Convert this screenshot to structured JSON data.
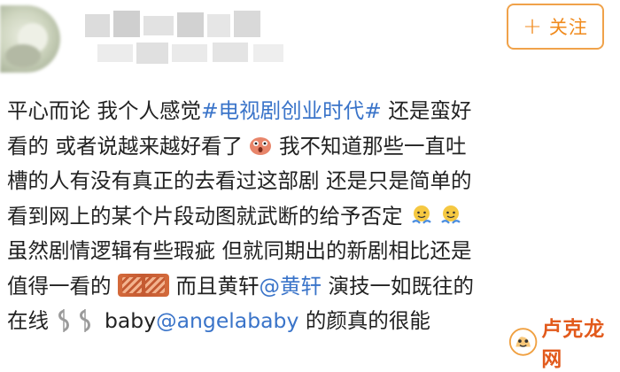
{
  "header": {
    "follow_button": {
      "plus_icon": "+",
      "label": "关注"
    }
  },
  "post": {
    "lines": [
      {
        "parts": [
          "平心而论  我个人感觉",
          "#电视剧创业时代#",
          " 还是蛮好"
        ]
      },
      {
        "parts": [
          "看的 或者说越来越好看了",
          "我不知道那些一直吐"
        ]
      },
      {
        "parts": [
          "槽的人有没有真正的去看过这部剧 还是只是简单的"
        ]
      },
      {
        "parts": [
          "看到网上的某个片段动图就武断的给予否定"
        ]
      },
      {
        "parts": [
          "虽然剧情逻辑有些瑕疵 但就同期出的新剧相比还是"
        ]
      },
      {
        "parts": [
          "值得一看的",
          "  而且黄轩",
          "@黄轩",
          "  演技一如既往的"
        ]
      },
      {
        "parts": [
          "在线",
          "  baby",
          "@angelababy",
          "  的颜真的很能"
        ]
      }
    ]
  },
  "watermark": {
    "text": "卢克龙网"
  },
  "colors": {
    "link": "#3a74c9",
    "follow": "#f08a1c",
    "watermark": "#e25a1c"
  },
  "icons": [
    "plus-icon",
    "surprised-face-icon",
    "doge-emoji-icon",
    "zan-emoji-icon",
    "coin-emoji-icon",
    "watermark-logo-icon"
  ]
}
